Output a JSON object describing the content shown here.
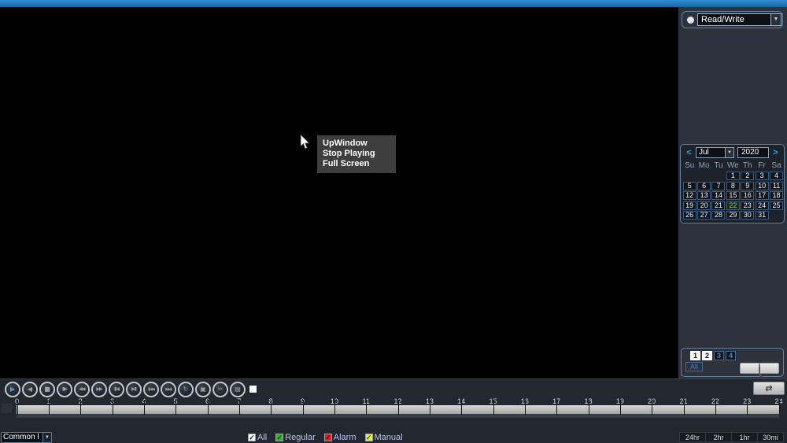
{
  "colors": {
    "titlebar_blue": "#1b76b8",
    "sidebar_bg": "#2e323c",
    "bottom_bg": "#23272f",
    "panel_border": "#667f99",
    "channel_text_blue": "#4e82ba",
    "selected_day_green": "#8ace6a",
    "play_accent_blue": "#4e9ad8"
  },
  "video": {
    "context_menu": {
      "items": [
        "UpWindow",
        "Stop Playing",
        "Full Screen"
      ]
    }
  },
  "sidebar": {
    "record_mode": {
      "value": "Read/Write",
      "dropdown_arrow": "▼"
    },
    "calendar": {
      "prev": "<",
      "next": ">",
      "month": "Jul",
      "month_dropdown_arrow": "▼",
      "year": "2020",
      "weekdays": [
        "Su",
        "Mo",
        "Tu",
        "We",
        "Th",
        "Fr",
        "Sa"
      ],
      "weeks": [
        [
          "",
          "",
          "",
          "1",
          "2",
          "3",
          "4"
        ],
        [
          "5",
          "6",
          "7",
          "8",
          "9",
          "10",
          "11"
        ],
        [
          "12",
          "13",
          "14",
          "15",
          "16",
          "17",
          "18"
        ],
        [
          "19",
          "20",
          "21",
          "22",
          "23",
          "24",
          "25"
        ],
        [
          "26",
          "27",
          "28",
          "29",
          "30",
          "31",
          ""
        ]
      ],
      "selected_day": "22"
    },
    "channels": {
      "items": [
        {
          "label": "1",
          "active": true
        },
        {
          "label": "2",
          "active": true
        },
        {
          "label": "3",
          "active": false
        },
        {
          "label": "4",
          "active": false
        }
      ],
      "all_label": "All",
      "search_icon": "magnifier-icon"
    }
  },
  "playback": {
    "buttons": [
      {
        "name": "play-button",
        "icon": "play-icon",
        "glyph": "▶",
        "accent": true
      },
      {
        "name": "reverse-play-button",
        "icon": "reverse-play-icon",
        "glyph": "◀",
        "accent": false
      },
      {
        "name": "stop-button",
        "icon": "stop-icon",
        "glyph": "■",
        "accent": false
      },
      {
        "name": "slow-play-button",
        "icon": "slow-play-icon",
        "glyph": "▮▶",
        "accent": false
      },
      {
        "name": "rewind-button",
        "icon": "rewind-icon",
        "glyph": "◀◀",
        "accent": false
      },
      {
        "name": "fast-forward-button",
        "icon": "fast-forward-icon",
        "glyph": "▶▶",
        "accent": false
      },
      {
        "name": "previous-frame-button",
        "icon": "previous-frame-icon",
        "glyph": "▮◀",
        "accent": false
      },
      {
        "name": "next-frame-button",
        "icon": "next-frame-icon",
        "glyph": "▶▮",
        "accent": false
      },
      {
        "name": "previous-file-button",
        "icon": "previous-file-icon",
        "glyph": "▮◀◀",
        "accent": false
      },
      {
        "name": "next-file-button",
        "icon": "next-file-icon",
        "glyph": "▶▶▮",
        "accent": false
      },
      {
        "name": "loop-playback-button",
        "icon": "loop-icon",
        "glyph": "↻",
        "accent": true
      },
      {
        "name": "display-mode-button",
        "icon": "window-icon",
        "glyph": "▣",
        "accent": false
      },
      {
        "name": "clip-button",
        "icon": "scissors-icon",
        "glyph": "✂",
        "accent": false
      },
      {
        "name": "backup-button",
        "icon": "save-icon",
        "glyph": "▤",
        "accent": false
      }
    ],
    "transfer_icon_glyph": "⇄"
  },
  "timeline": {
    "hours": [
      "0",
      "1",
      "2",
      "3",
      "4",
      "5",
      "6",
      "7",
      "8",
      "9",
      "10",
      "11",
      "12",
      "13",
      "14",
      "15",
      "16",
      "17",
      "18",
      "19",
      "20",
      "21",
      "22",
      "23",
      "24"
    ]
  },
  "footer": {
    "mode_select": {
      "value": "Common l",
      "dropdown_arrow": "▼"
    },
    "filters": [
      {
        "label": "All",
        "box_color": "#ffffff",
        "check_color": "#1a1a1a",
        "check": "✓"
      },
      {
        "label": "Regular",
        "box_color": "#3fae3f",
        "check_color": "#0e4a0e",
        "check": "✓"
      },
      {
        "label": "Alarm",
        "box_color": "#cc2a2a",
        "check_color": "#5a0f0f",
        "check": "✓"
      },
      {
        "label": "Manual",
        "box_color": "#e9e95c",
        "check_color": "#55551a",
        "check": "✓"
      }
    ],
    "ranges": [
      "24hr",
      "2hr",
      "1hr",
      "30mi"
    ]
  }
}
